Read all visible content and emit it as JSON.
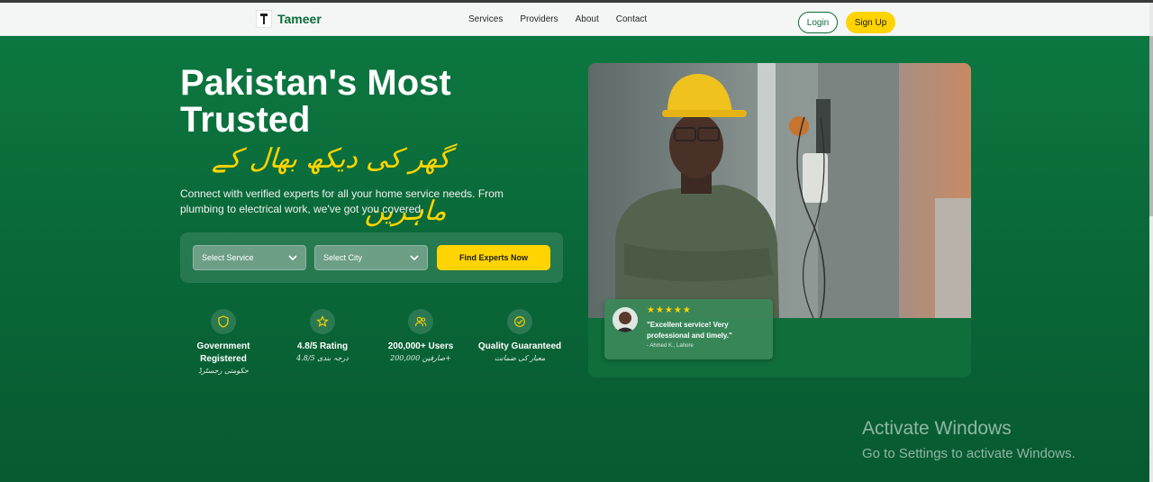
{
  "header": {
    "brand": "Tameer",
    "nav": [
      "Services",
      "Providers",
      "About",
      "Contact"
    ],
    "login_label": "Login",
    "signup_label": "Sign Up"
  },
  "hero": {
    "title": "Pakistan's Most Trusted",
    "urdu_tagline": "گھر کی دیکھ بھال کے ماہرین",
    "subtitle": "Connect with verified experts for all your home service needs. From plumbing to electrical work, we've got you covered."
  },
  "search": {
    "service_select": "Select Service",
    "city_select": "Select City",
    "find_button": "Find Experts Now"
  },
  "stats": [
    {
      "icon": "shield-icon",
      "title": "Government Registered",
      "urdu": "حکومتی رجسٹرڈ"
    },
    {
      "icon": "star-icon",
      "title": "4.8/5 Rating",
      "urdu": "درجہ بندی 4.8/5"
    },
    {
      "icon": "users-icon",
      "title": "200,000+ Users",
      "urdu": "صارفین 200,000+"
    },
    {
      "icon": "check-circle-icon",
      "title": "Quality Guaranteed",
      "urdu": "معیار کی ضمانت"
    }
  ],
  "review": {
    "stars": "★★★★★",
    "quote": "\"Excellent service! Very professional and timely.\"",
    "author": "- Ahmed K., Lahore"
  },
  "watermark": {
    "title": "Activate Windows",
    "subtitle": "Go to Settings to activate Windows."
  },
  "colors": {
    "brand_green": "#0c6b3a",
    "accent_yellow": "#ffd400",
    "hero_bg": "#0a6a39"
  }
}
